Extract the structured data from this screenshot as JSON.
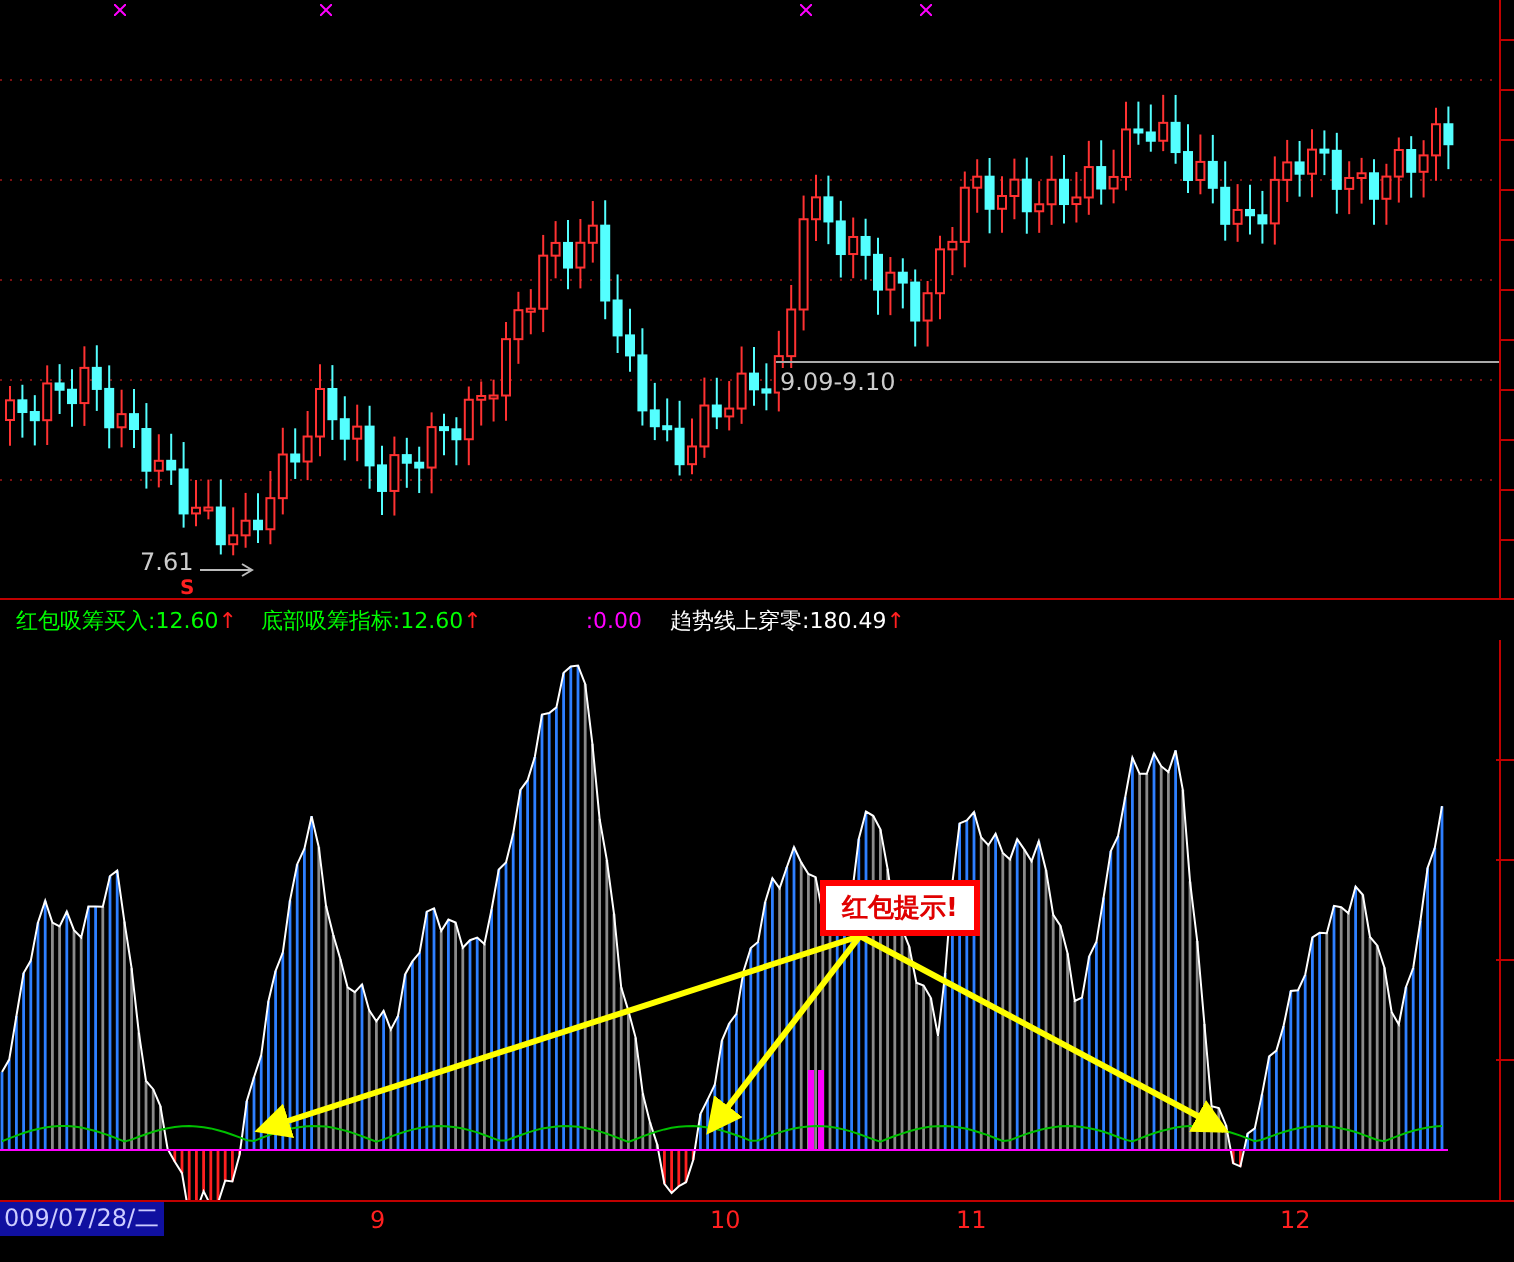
{
  "price_panel": {
    "low_marker": "7.61",
    "sell_signal": "S",
    "range_label": "9.09-9.10"
  },
  "indicator_legend": [
    {
      "label": "红包吸筹买入:12.60",
      "arrow": "↑",
      "color": "#00ff00"
    },
    {
      "label": "底部吸筹指标:12.60",
      "arrow": "↑",
      "color": "#00ff00"
    },
    {
      "label": ":0.00",
      "color": "#ff00ff"
    },
    {
      "label": "趋势线上穿零:180.49",
      "arrow": "↑",
      "color": "#ffffff"
    }
  ],
  "callout": "红包提示!",
  "date_axis": {
    "start": "009/07/28/二",
    "months": [
      "9",
      "10",
      "11",
      "12"
    ]
  }
}
